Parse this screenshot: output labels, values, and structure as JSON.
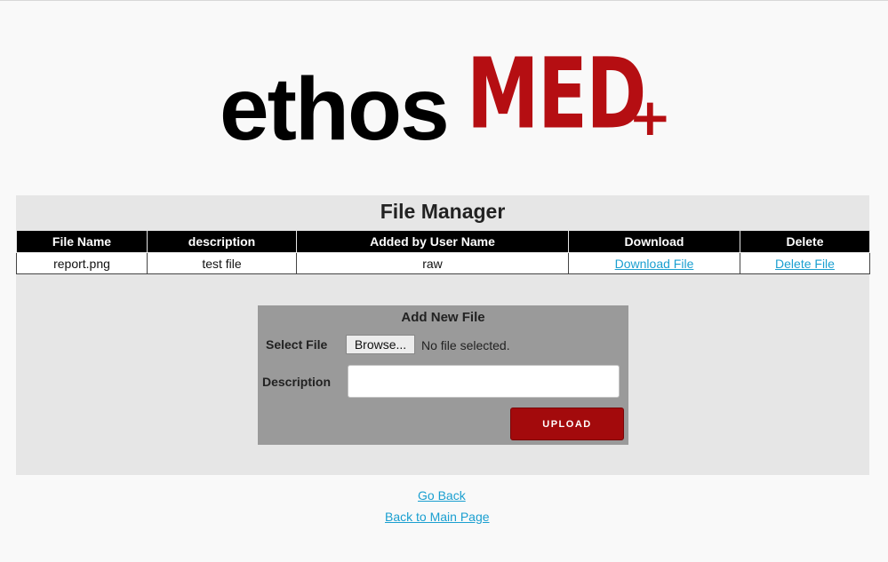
{
  "logo": {
    "part1": "ethos",
    "part2": "MED",
    "part3": "+"
  },
  "panel": {
    "title": "File Manager"
  },
  "table": {
    "headers": [
      "File Name",
      "description",
      "Added by User Name",
      "Download",
      "Delete"
    ],
    "rows": [
      {
        "file_name": "report.png",
        "description": "test file",
        "added_by": "raw",
        "download": "Download File",
        "delete": "Delete File"
      }
    ]
  },
  "upload": {
    "title": "Add New File",
    "select_label": "Select File",
    "browse_label": "Browse...",
    "file_status": "No file selected.",
    "description_label": "Description",
    "description_value": "",
    "upload_label": "UPLOAD"
  },
  "links": {
    "go_back": "Go Back",
    "main_page": "Back to Main Page"
  },
  "colors": {
    "brand_red": "#b50e12",
    "link": "#1a9fd0",
    "button": "#a30a0c"
  }
}
